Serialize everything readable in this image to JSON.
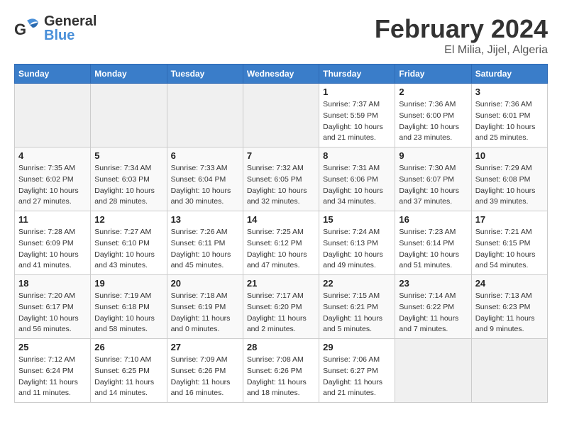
{
  "header": {
    "logo_line1": "General",
    "logo_line2": "Blue",
    "title": "February 2024",
    "subtitle": "El Milia, Jijel, Algeria"
  },
  "weekdays": [
    "Sunday",
    "Monday",
    "Tuesday",
    "Wednesday",
    "Thursday",
    "Friday",
    "Saturday"
  ],
  "weeks": [
    [
      {
        "day": "",
        "info": ""
      },
      {
        "day": "",
        "info": ""
      },
      {
        "day": "",
        "info": ""
      },
      {
        "day": "",
        "info": ""
      },
      {
        "day": "1",
        "info": "Sunrise: 7:37 AM\nSunset: 5:59 PM\nDaylight: 10 hours\nand 21 minutes."
      },
      {
        "day": "2",
        "info": "Sunrise: 7:36 AM\nSunset: 6:00 PM\nDaylight: 10 hours\nand 23 minutes."
      },
      {
        "day": "3",
        "info": "Sunrise: 7:36 AM\nSunset: 6:01 PM\nDaylight: 10 hours\nand 25 minutes."
      }
    ],
    [
      {
        "day": "4",
        "info": "Sunrise: 7:35 AM\nSunset: 6:02 PM\nDaylight: 10 hours\nand 27 minutes."
      },
      {
        "day": "5",
        "info": "Sunrise: 7:34 AM\nSunset: 6:03 PM\nDaylight: 10 hours\nand 28 minutes."
      },
      {
        "day": "6",
        "info": "Sunrise: 7:33 AM\nSunset: 6:04 PM\nDaylight: 10 hours\nand 30 minutes."
      },
      {
        "day": "7",
        "info": "Sunrise: 7:32 AM\nSunset: 6:05 PM\nDaylight: 10 hours\nand 32 minutes."
      },
      {
        "day": "8",
        "info": "Sunrise: 7:31 AM\nSunset: 6:06 PM\nDaylight: 10 hours\nand 34 minutes."
      },
      {
        "day": "9",
        "info": "Sunrise: 7:30 AM\nSunset: 6:07 PM\nDaylight: 10 hours\nand 37 minutes."
      },
      {
        "day": "10",
        "info": "Sunrise: 7:29 AM\nSunset: 6:08 PM\nDaylight: 10 hours\nand 39 minutes."
      }
    ],
    [
      {
        "day": "11",
        "info": "Sunrise: 7:28 AM\nSunset: 6:09 PM\nDaylight: 10 hours\nand 41 minutes."
      },
      {
        "day": "12",
        "info": "Sunrise: 7:27 AM\nSunset: 6:10 PM\nDaylight: 10 hours\nand 43 minutes."
      },
      {
        "day": "13",
        "info": "Sunrise: 7:26 AM\nSunset: 6:11 PM\nDaylight: 10 hours\nand 45 minutes."
      },
      {
        "day": "14",
        "info": "Sunrise: 7:25 AM\nSunset: 6:12 PM\nDaylight: 10 hours\nand 47 minutes."
      },
      {
        "day": "15",
        "info": "Sunrise: 7:24 AM\nSunset: 6:13 PM\nDaylight: 10 hours\nand 49 minutes."
      },
      {
        "day": "16",
        "info": "Sunrise: 7:23 AM\nSunset: 6:14 PM\nDaylight: 10 hours\nand 51 minutes."
      },
      {
        "day": "17",
        "info": "Sunrise: 7:21 AM\nSunset: 6:15 PM\nDaylight: 10 hours\nand 54 minutes."
      }
    ],
    [
      {
        "day": "18",
        "info": "Sunrise: 7:20 AM\nSunset: 6:17 PM\nDaylight: 10 hours\nand 56 minutes."
      },
      {
        "day": "19",
        "info": "Sunrise: 7:19 AM\nSunset: 6:18 PM\nDaylight: 10 hours\nand 58 minutes."
      },
      {
        "day": "20",
        "info": "Sunrise: 7:18 AM\nSunset: 6:19 PM\nDaylight: 11 hours\nand 0 minutes."
      },
      {
        "day": "21",
        "info": "Sunrise: 7:17 AM\nSunset: 6:20 PM\nDaylight: 11 hours\nand 2 minutes."
      },
      {
        "day": "22",
        "info": "Sunrise: 7:15 AM\nSunset: 6:21 PM\nDaylight: 11 hours\nand 5 minutes."
      },
      {
        "day": "23",
        "info": "Sunrise: 7:14 AM\nSunset: 6:22 PM\nDaylight: 11 hours\nand 7 minutes."
      },
      {
        "day": "24",
        "info": "Sunrise: 7:13 AM\nSunset: 6:23 PM\nDaylight: 11 hours\nand 9 minutes."
      }
    ],
    [
      {
        "day": "25",
        "info": "Sunrise: 7:12 AM\nSunset: 6:24 PM\nDaylight: 11 hours\nand 11 minutes."
      },
      {
        "day": "26",
        "info": "Sunrise: 7:10 AM\nSunset: 6:25 PM\nDaylight: 11 hours\nand 14 minutes."
      },
      {
        "day": "27",
        "info": "Sunrise: 7:09 AM\nSunset: 6:26 PM\nDaylight: 11 hours\nand 16 minutes."
      },
      {
        "day": "28",
        "info": "Sunrise: 7:08 AM\nSunset: 6:26 PM\nDaylight: 11 hours\nand 18 minutes."
      },
      {
        "day": "29",
        "info": "Sunrise: 7:06 AM\nSunset: 6:27 PM\nDaylight: 11 hours\nand 21 minutes."
      },
      {
        "day": "",
        "info": ""
      },
      {
        "day": "",
        "info": ""
      }
    ]
  ]
}
